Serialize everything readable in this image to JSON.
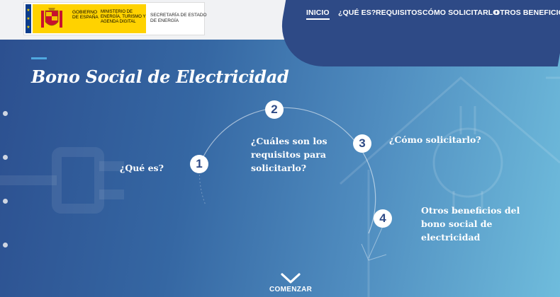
{
  "header": {
    "gov_label": "GOBIERNO DE ESPAÑA",
    "ministry_label": "MINISTERIO DE ENERGÍA, TURISMO Y AGENDA DIGITAL",
    "secretariat_label": "SECRETARÍA DE ESTADO DE ENERGÍA"
  },
  "nav": {
    "items": [
      "INICIO",
      "¿QUÉ ES?",
      "REQUISITOS",
      "CÓMO SOLICITARLO",
      "OTROS BENEFICIOS"
    ],
    "active": "INICIO"
  },
  "hero": {
    "title": "Bono Social de Electricidad",
    "steps": [
      {
        "number": "1",
        "label": "¿Qué es?"
      },
      {
        "number": "2",
        "label": "¿Cuáles son los requisitos para solicitarlo?"
      },
      {
        "number": "3",
        "label": "¿Cómo solicitarlo?"
      },
      {
        "number": "4",
        "label": "Otros beneficios del bono social de electricidad"
      }
    ],
    "cta_label": "COMENZAR"
  },
  "colors": {
    "nav_panel": "#2e4a86",
    "hero_start": "#2c4f8f",
    "hero_end": "#6fbcdc",
    "accent": "#4fa8df"
  }
}
